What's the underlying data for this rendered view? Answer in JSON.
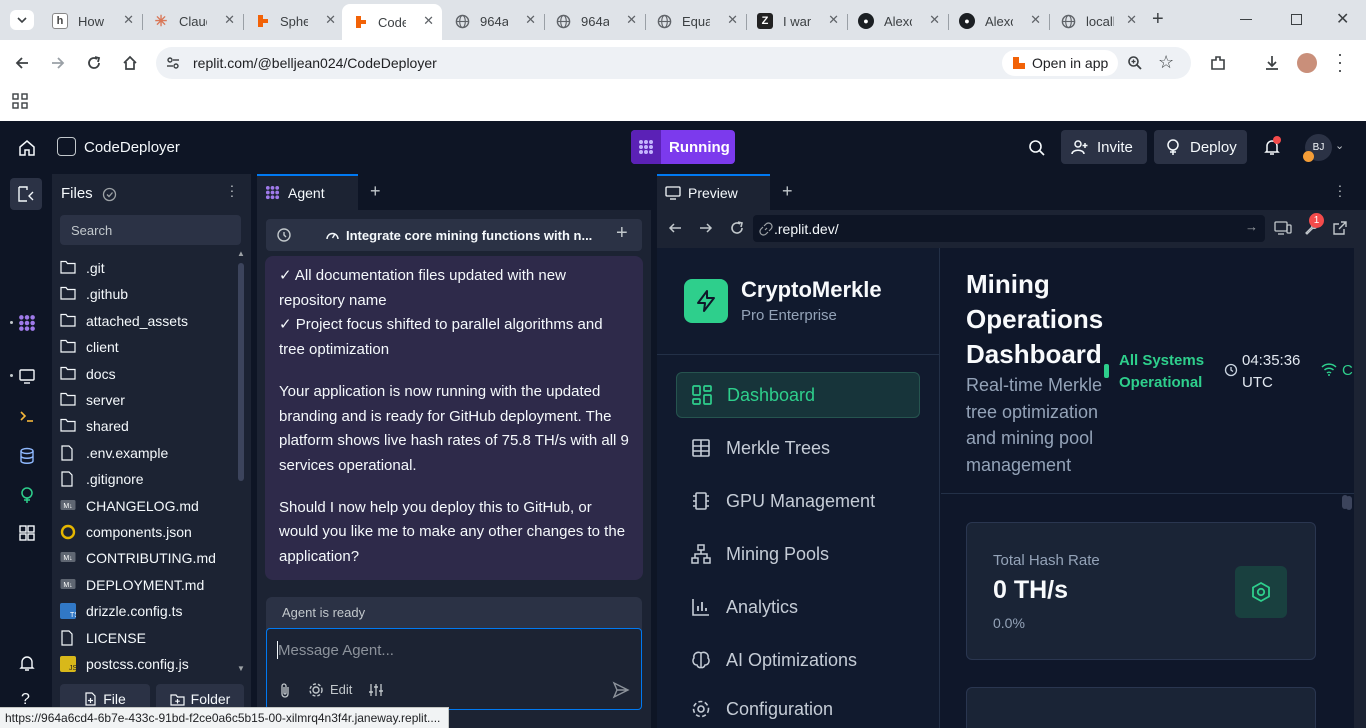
{
  "browser": {
    "tabs": [
      {
        "title": "How t",
        "icon": "generic-icon"
      },
      {
        "title": "Claud",
        "icon": "claude-icon"
      },
      {
        "title": "Spher",
        "icon": "replit-icon"
      },
      {
        "title": "Code",
        "icon": "replit-icon",
        "active": true
      },
      {
        "title": "964a6",
        "icon": "globe-icon"
      },
      {
        "title": "964a6",
        "icon": "globe-icon"
      },
      {
        "title": "Equat",
        "icon": "globe-icon"
      },
      {
        "title": "I wan",
        "icon": "z-icon"
      },
      {
        "title": "Alexc",
        "icon": "github-icon"
      },
      {
        "title": "Alexc",
        "icon": "github-icon"
      },
      {
        "title": "localh",
        "icon": "globe-icon"
      }
    ],
    "url": "replit.com/@belljean024/CodeDeployer",
    "open_in_app": "Open in app",
    "status_url": "https://964a6cd4-6b7e-433c-91bd-f2ce0a6c5b15-00-xilmrq4n3f4r.janeway.replit...."
  },
  "header": {
    "project": "CodeDeployer",
    "status": "Running",
    "invite": "Invite",
    "deploy": "Deploy",
    "avatar": "BJ"
  },
  "files": {
    "title": "Files",
    "search_placeholder": "Search",
    "items": [
      {
        "name": ".git",
        "type": "folder"
      },
      {
        "name": ".github",
        "type": "folder"
      },
      {
        "name": "attached_assets",
        "type": "folder"
      },
      {
        "name": "client",
        "type": "folder"
      },
      {
        "name": "docs",
        "type": "folder"
      },
      {
        "name": "server",
        "type": "folder"
      },
      {
        "name": "shared",
        "type": "folder"
      },
      {
        "name": ".env.example",
        "type": "file"
      },
      {
        "name": ".gitignore",
        "type": "file"
      },
      {
        "name": "CHANGELOG.md",
        "type": "md"
      },
      {
        "name": "components.json",
        "type": "json"
      },
      {
        "name": "CONTRIBUTING.md",
        "type": "md"
      },
      {
        "name": "DEPLOYMENT.md",
        "type": "md"
      },
      {
        "name": "drizzle.config.ts",
        "type": "ts"
      },
      {
        "name": "LICENSE",
        "type": "file"
      },
      {
        "name": "postcss.config.js",
        "type": "js"
      }
    ],
    "new_file": "File",
    "new_folder": "Folder"
  },
  "agent": {
    "tab": "Agent",
    "thread_title": "Integrate core mining functions with n...",
    "message": {
      "line1": "✓ All documentation files updated with new repository name",
      "line2": "✓ Project focus shifted to parallel algorithms and tree optimization",
      "para1": "Your application is now running with the updated branding and is ready for GitHub deployment. The platform shows live hash rates of 75.8 TH/s with all 9 services operational.",
      "para2": "Should I now help you deploy this to GitHub, or would you like me to make any other changes to the application?"
    },
    "status": "Agent is ready",
    "input_placeholder": "Message Agent...",
    "edit_label": "Edit"
  },
  "preview": {
    "tab": "Preview",
    "url": ".replit.dev/",
    "badge_count": "1",
    "app": {
      "brand": "CryptoMerkle",
      "brand_sub": "Pro Enterprise",
      "nav": [
        {
          "label": "Dashboard",
          "icon": "dashboard-icon",
          "active": true
        },
        {
          "label": "Merkle Trees",
          "icon": "table-icon"
        },
        {
          "label": "GPU Management",
          "icon": "chip-icon"
        },
        {
          "label": "Mining Pools",
          "icon": "network-icon"
        },
        {
          "label": "Analytics",
          "icon": "bar-chart-icon"
        },
        {
          "label": "AI Optimizations",
          "icon": "brain-icon"
        },
        {
          "label": "Configuration",
          "icon": "gear-icon"
        }
      ],
      "title_lines": [
        "Mining",
        "Operations",
        "Dashboard"
      ],
      "subtitle_lines": [
        "Real-time Merkle",
        "tree optimization",
        "and mining pool",
        "management"
      ],
      "system_status_lines": [
        "All Systems",
        "Operational"
      ],
      "time_lines": [
        "04:35:36",
        "UTC"
      ],
      "card": {
        "label": "Total Hash Rate",
        "value": "0 TH/s",
        "change": "0.0%"
      }
    }
  },
  "colors": {
    "accent_green": "#2ecf8c",
    "running_purple": "#7c3aed",
    "panel": "#1c2333",
    "bg": "#0e1525"
  }
}
